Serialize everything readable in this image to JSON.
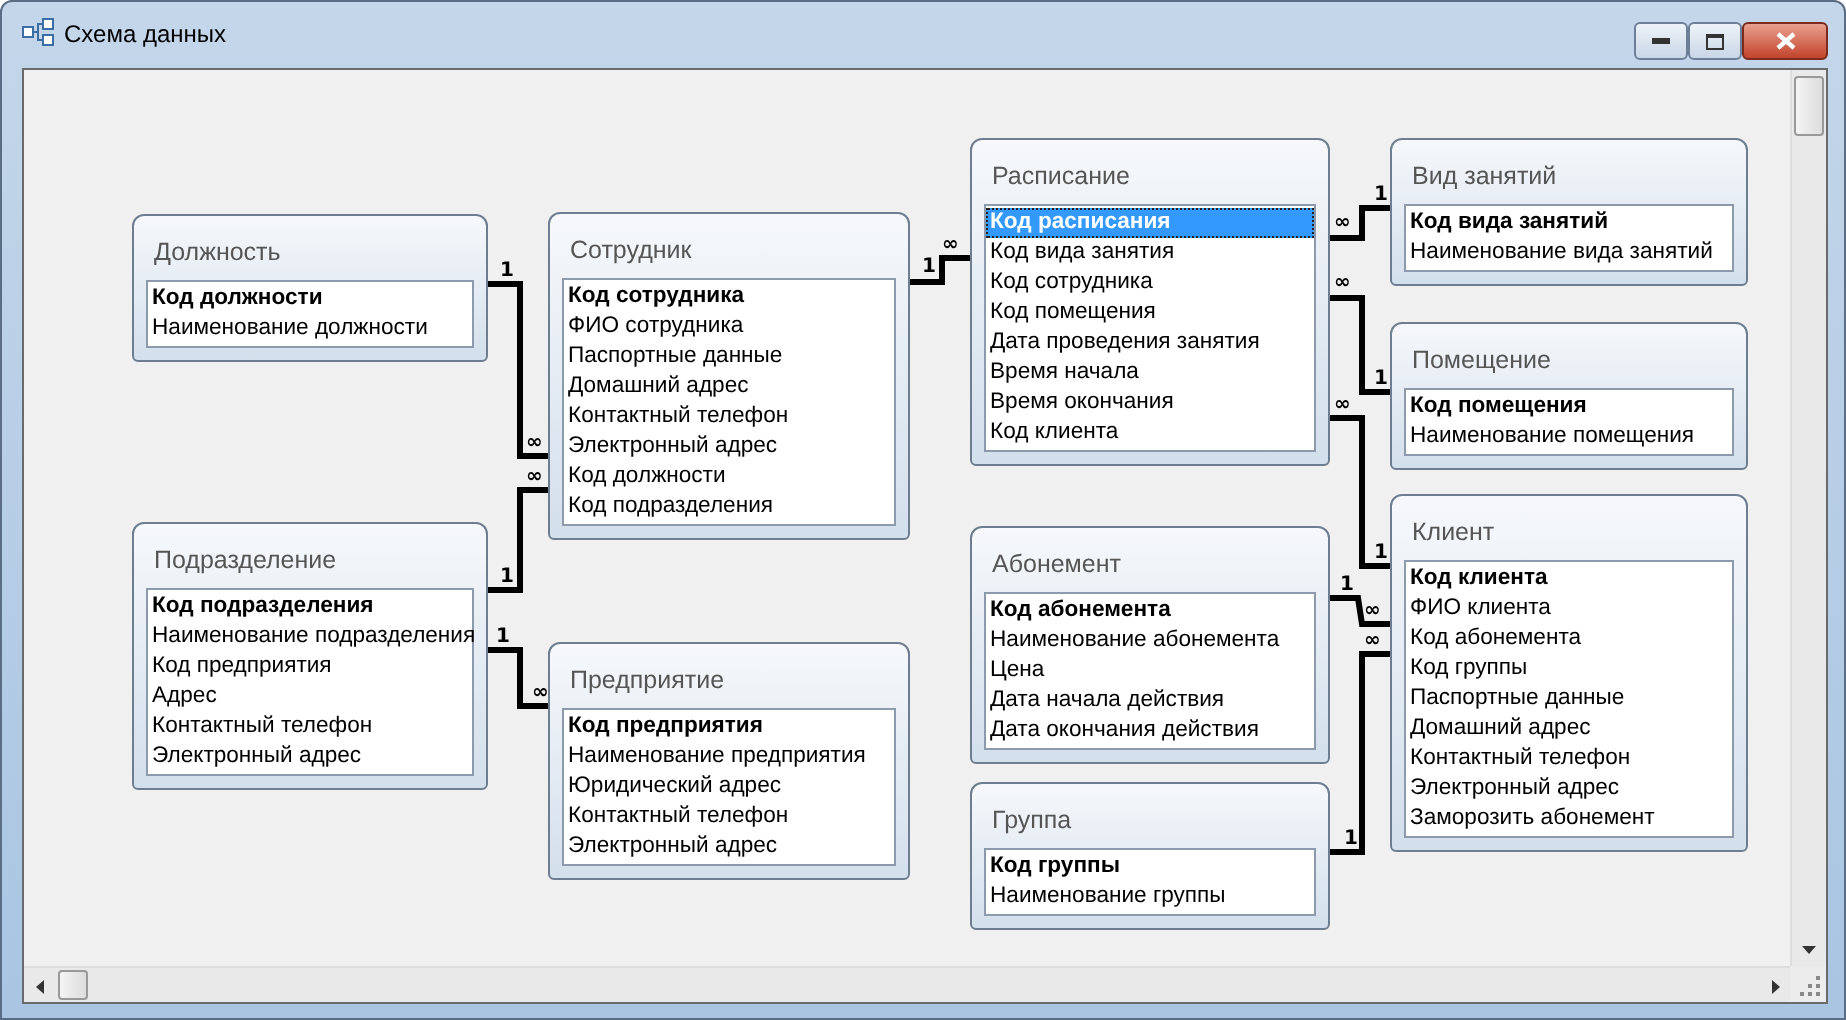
{
  "window": {
    "title": "Схема данных"
  },
  "tables": [
    {
      "title": "Должность",
      "fields": [
        {
          "name": "Код должности",
          "key": true,
          "selected": false
        },
        {
          "name": "Наименование должности",
          "key": false,
          "selected": false
        }
      ]
    },
    {
      "title": "Сотрудник",
      "fields": [
        {
          "name": "Код сотрудника",
          "key": true,
          "selected": false
        },
        {
          "name": "ФИО сотрудника",
          "key": false,
          "selected": false
        },
        {
          "name": "Паспортные данные",
          "key": false,
          "selected": false
        },
        {
          "name": "Домашний адрес",
          "key": false,
          "selected": false
        },
        {
          "name": "Контактный телефон",
          "key": false,
          "selected": false
        },
        {
          "name": "Электронный адрес",
          "key": false,
          "selected": false
        },
        {
          "name": "Код должности",
          "key": false,
          "selected": false
        },
        {
          "name": "Код подразделения",
          "key": false,
          "selected": false
        }
      ]
    },
    {
      "title": "Подразделение",
      "fields": [
        {
          "name": "Код подразделения",
          "key": true,
          "selected": false
        },
        {
          "name": "Наименование подразделения",
          "key": false,
          "selected": false
        },
        {
          "name": "Код предприятия",
          "key": false,
          "selected": false
        },
        {
          "name": "Адрес",
          "key": false,
          "selected": false
        },
        {
          "name": "Контактный телефон",
          "key": false,
          "selected": false
        },
        {
          "name": "Электронный адрес",
          "key": false,
          "selected": false
        }
      ]
    },
    {
      "title": "Предприятие",
      "fields": [
        {
          "name": "Код предприятия",
          "key": true,
          "selected": false
        },
        {
          "name": "Наименование предприятия",
          "key": false,
          "selected": false
        },
        {
          "name": "Юридический адрес",
          "key": false,
          "selected": false
        },
        {
          "name": "Контактный телефон",
          "key": false,
          "selected": false
        },
        {
          "name": "Электронный адрес",
          "key": false,
          "selected": false
        }
      ]
    },
    {
      "title": "Расписание",
      "fields": [
        {
          "name": "Код расписания",
          "key": true,
          "selected": true
        },
        {
          "name": "Код вида занятия",
          "key": false,
          "selected": false
        },
        {
          "name": "Код сотрудника",
          "key": false,
          "selected": false
        },
        {
          "name": "Код помещения",
          "key": false,
          "selected": false
        },
        {
          "name": "Дата проведения занятия",
          "key": false,
          "selected": false
        },
        {
          "name": "Время начала",
          "key": false,
          "selected": false
        },
        {
          "name": "Время окончания",
          "key": false,
          "selected": false
        },
        {
          "name": "Код клиента",
          "key": false,
          "selected": false
        }
      ]
    },
    {
      "title": "Вид занятий",
      "fields": [
        {
          "name": "Код вида занятий",
          "key": true,
          "selected": false
        },
        {
          "name": "Наименование вида занятий",
          "key": false,
          "selected": false
        }
      ]
    },
    {
      "title": "Помещение",
      "fields": [
        {
          "name": "Код помещения",
          "key": true,
          "selected": false
        },
        {
          "name": "Наименование помещения",
          "key": false,
          "selected": false
        }
      ]
    },
    {
      "title": "Абонемент",
      "fields": [
        {
          "name": "Код абонемента",
          "key": true,
          "selected": false
        },
        {
          "name": "Наименование абонемента",
          "key": false,
          "selected": false
        },
        {
          "name": "Цена",
          "key": false,
          "selected": false
        },
        {
          "name": "Дата начала действия",
          "key": false,
          "selected": false
        },
        {
          "name": "Дата окончания действия",
          "key": false,
          "selected": false
        }
      ]
    },
    {
      "title": "Группа",
      "fields": [
        {
          "name": "Код группы",
          "key": true,
          "selected": false
        },
        {
          "name": "Наименование группы",
          "key": false,
          "selected": false
        }
      ]
    },
    {
      "title": "Клиент",
      "fields": [
        {
          "name": "Код клиента",
          "key": true,
          "selected": false
        },
        {
          "name": "ФИО клиента",
          "key": false,
          "selected": false
        },
        {
          "name": "Код абонемента",
          "key": false,
          "selected": false
        },
        {
          "name": "Код группы",
          "key": false,
          "selected": false
        },
        {
          "name": "Паспортные данные",
          "key": false,
          "selected": false
        },
        {
          "name": "Домашний адрес",
          "key": false,
          "selected": false
        },
        {
          "name": "Контактный телефон",
          "key": false,
          "selected": false
        },
        {
          "name": "Электронный адрес",
          "key": false,
          "selected": false
        },
        {
          "name": "Заморозить абонемент",
          "key": false,
          "selected": false
        }
      ]
    }
  ],
  "relationships": [
    {
      "one": "1",
      "many": "∞"
    },
    {
      "one": "1",
      "many": "∞"
    },
    {
      "one": "1",
      "many": "∞"
    },
    {
      "one": "1",
      "many": "∞"
    },
    {
      "one": "1",
      "many": "∞"
    },
    {
      "one": "1",
      "many": "∞"
    },
    {
      "one": "1",
      "many": "∞"
    },
    {
      "one": "1",
      "many": "∞"
    },
    {
      "one": "1",
      "many": "∞"
    }
  ]
}
